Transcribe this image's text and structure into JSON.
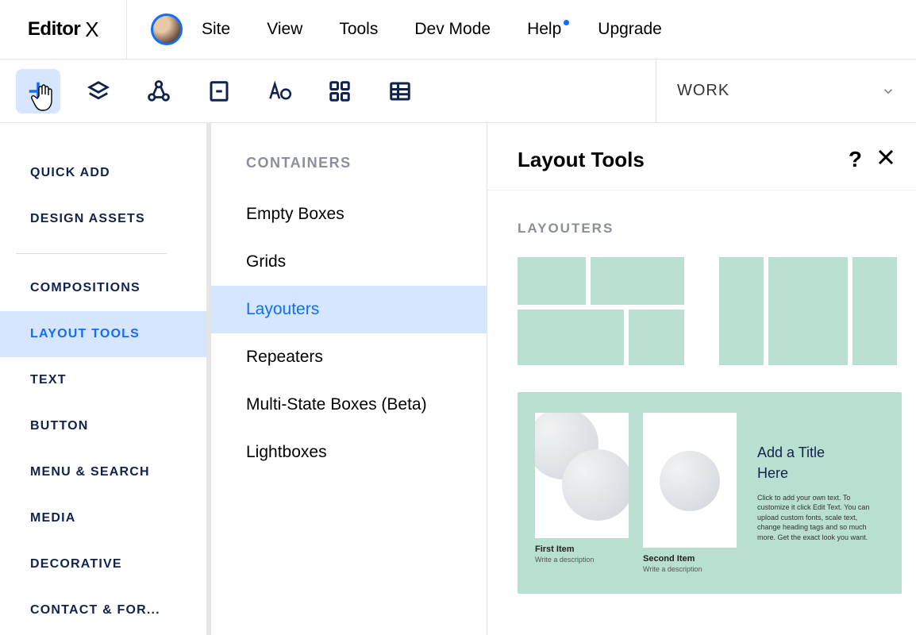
{
  "logo": "Editor",
  "logo_x": "X",
  "topMenu": [
    "Site",
    "View",
    "Tools",
    "Dev Mode",
    "Help",
    "Upgrade"
  ],
  "pageDropdown": "WORK",
  "sidebar1": {
    "top": [
      "Quick Add",
      "Design Assets"
    ],
    "bottom": [
      "Compositions",
      "Layout Tools",
      "Text",
      "Button",
      "Menu & Search",
      "Media",
      "Decorative",
      "Contact & For..."
    ],
    "selected": "Layout Tools"
  },
  "sidebar2": {
    "heading": "CONTAINERS",
    "items": [
      "Empty Boxes",
      "Grids",
      "Layouters",
      "Repeaters",
      "Multi-State Boxes (Beta)",
      "Lightboxes"
    ],
    "selected": "Layouters"
  },
  "content": {
    "title": "Layout Tools",
    "sectionLabel": "LAYOUTERS",
    "card": {
      "firstItem": "First Item",
      "firstDesc": "Write a description",
      "secondItem": "Second Item",
      "secondDesc": "Write a description",
      "titleLine1": "Add a Title",
      "titleLine2": "Here",
      "desc": "Click to add your own text. To customize it click Edit Text. You can upload custom fonts, scale text, change heading tags and so much more. Get the exact look you want."
    }
  }
}
